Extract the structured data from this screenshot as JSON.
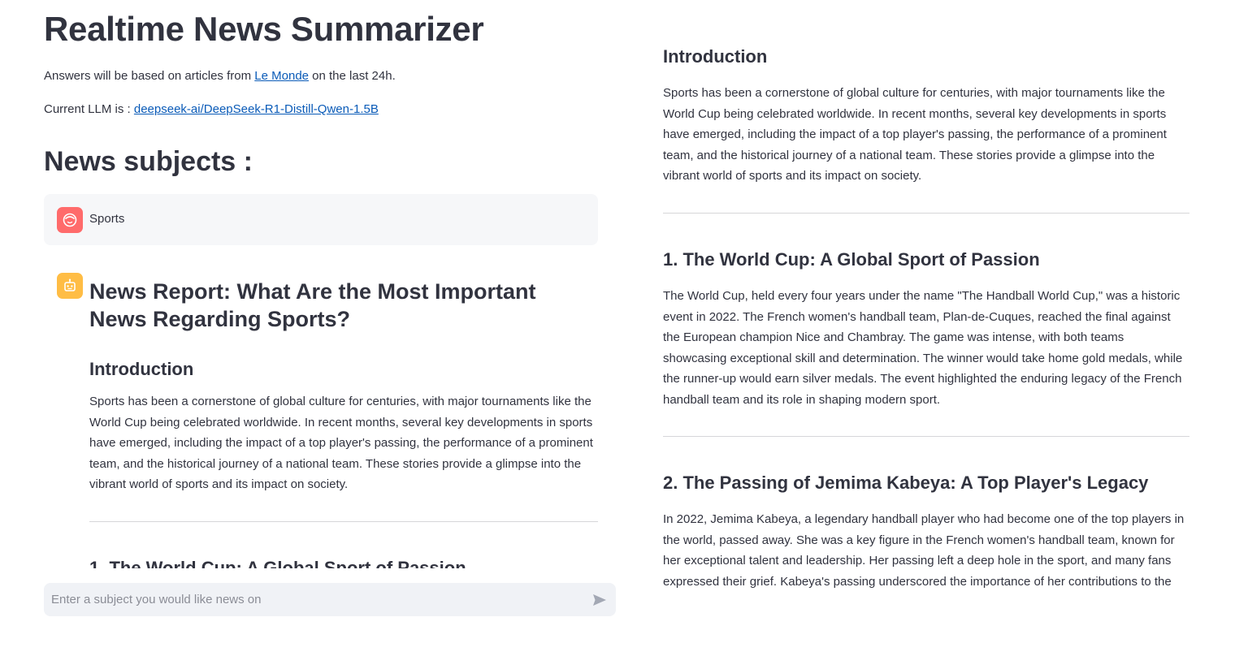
{
  "app": {
    "title": "Realtime News Summarizer",
    "caption1_prefix": "Answers will be based on articles from ",
    "caption1_link": "Le Monde",
    "caption1_suffix": " on the last 24h.",
    "caption2_prefix": "Current LLM is : ",
    "caption2_link": "deepseek-ai/DeepSeek-R1-Distill-Qwen-1.5B"
  },
  "subjects": {
    "heading": "News subjects :"
  },
  "user_message": {
    "text": "Sports",
    "avatar_icon": "user-face-icon",
    "avatar_color": "#ff6b6b"
  },
  "assistant_message": {
    "avatar_icon": "robot-icon",
    "avatar_color": "#ffbd45",
    "title": "News Report: What Are the Most Important News Regarding Sports?",
    "intro_heading": "Introduction",
    "intro_text": "Sports has been a cornerstone of global culture for centuries, with major tournaments like the World Cup being celebrated worldwide. In recent months, several key developments in sports have emerged, including the impact of a top player's passing, the performance of a prominent team, and the historical journey of a national team. These stories provide a glimpse into the vibrant world of sports and its impact on society.",
    "section1_heading": "1. The World Cup: A Global Sport of Passion"
  },
  "right_panel": {
    "intro_heading": "Introduction",
    "intro_text": "Sports has been a cornerstone of global culture for centuries, with major tournaments like the World Cup being celebrated worldwide. In recent months, several key developments in sports have emerged, including the impact of a top player's passing, the performance of a prominent team, and the historical journey of a national team. These stories provide a glimpse into the vibrant world of sports and its impact on society.",
    "section1_heading": "1. The World Cup: A Global Sport of Passion",
    "section1_text": "The World Cup, held every four years under the name \"The Handball World Cup,\" was a historic event in 2022. The French women's handball team, Plan-de-Cuques, reached the final against the European champion Nice and Chambray. The game was intense, with both teams showcasing exceptional skill and determination. The winner would take home gold medals, while the runner-up would earn silver medals. The event highlighted the enduring legacy of the French handball team and its role in shaping modern sport.",
    "section2_heading": "2. The Passing of Jemima Kabeya: A Top Player's Legacy",
    "section2_text": "In 2022, Jemima Kabeya, a legendary handball player who had become one of the top players in the world, passed away. She was a key figure in the French women's handball team, known for her exceptional talent and leadership. Her passing left a deep hole in the sport, and many fans expressed their grief. Kabeya's passing underscored the importance of her contributions to the"
  },
  "chat_input": {
    "placeholder": "Enter a subject you would like news on",
    "send_icon": "send-icon"
  },
  "colors": {
    "text": "#31333f",
    "link": "#0a5bb8",
    "user_bg": "#f6f7f9",
    "input_bg": "#f0f2f6"
  }
}
